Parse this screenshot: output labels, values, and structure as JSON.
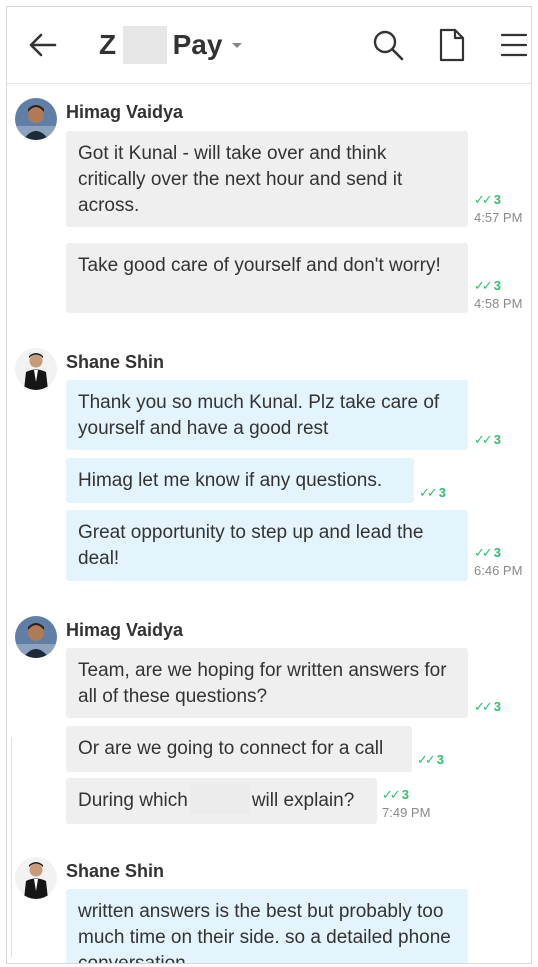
{
  "header": {
    "title_prefix": "Z",
    "title_suffix": "Pay"
  },
  "colors": {
    "tick": "#2fbf71",
    "bubble_grey": "#efefef",
    "bubble_blue": "#e3f4fd"
  },
  "messages": [
    {
      "sender": "Himag Vaidya"
    },
    {
      "text": "Got it Kunal - will take over and think critically over the next hour and send it across.",
      "receipt": "3",
      "time": "4:57 PM"
    },
    {
      "text": "Take good care of yourself and don't worry!",
      "receipt": "3",
      "time": "4:58 PM"
    },
    {
      "sender": "Shane Shin"
    },
    {
      "text": "Thank you so much Kunal.   Plz take care of yourself and have a good rest",
      "receipt": "3"
    },
    {
      "text": "Himag let me know if any questions.",
      "receipt": "3"
    },
    {
      "text": "Great opportunity to step up and lead the deal!",
      "receipt": "3",
      "time": "6:46 PM"
    },
    {
      "sender": "Himag Vaidya"
    },
    {
      "text": "Team, are we hoping for written answers for all of these questions?",
      "receipt": "3"
    },
    {
      "text": "Or are we going to connect for a call",
      "receipt": "3"
    },
    {
      "text_before": "During which",
      "text_after": "will explain?",
      "receipt": "3",
      "time": "7:49 PM"
    },
    {
      "sender": "Shane Shin"
    },
    {
      "text": "written answers is the best but probably too much time on their side. so a detailed phone conversation"
    }
  ],
  "icons": [
    "back-arrow-icon",
    "search-icon",
    "document-icon",
    "menu-icon",
    "read-receipt-icon"
  ]
}
